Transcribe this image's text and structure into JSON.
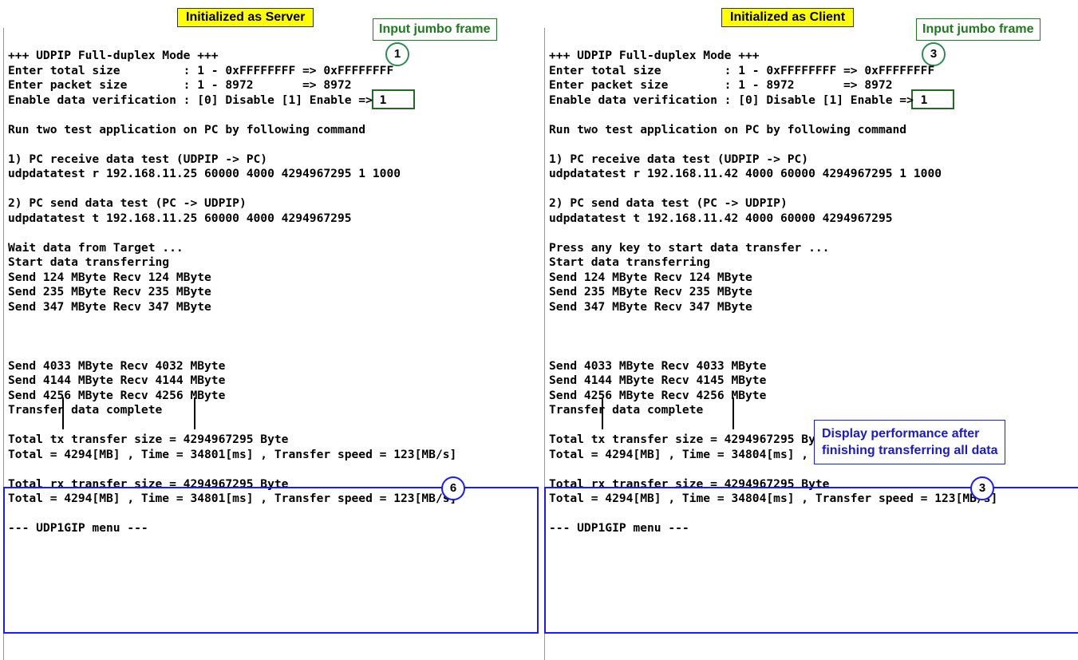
{
  "server": {
    "title": "Initialized as Server",
    "callout": "Input jumbo frame",
    "callout_step": "1",
    "result_step": "6",
    "lines": [
      "+++ UDPIP Full-duplex Mode +++",
      "Enter total size         : 1 - 0xFFFFFFFF => 0xFFFFFFFF",
      "Enter packet size        : 1 - 8972       => 8972",
      "Enable data verification : [0] Disable [1] Enable => 1",
      "Run two test application on PC by following command",
      "1) PC receive data test (UDPIP -> PC)",
      "udpdatatest r 192.168.11.25 60000 4000 4294967295 1 1000",
      "2) PC send data test (PC -> UDPIP)",
      "udpdatatest t 192.168.11.25 60000 4000 4294967295",
      "Wait data from Target ...",
      "Start data transferring",
      "Send 124 MByte Recv 124 MByte",
      "Send 235 MByte Recv 235 MByte",
      "Send 347 MByte Recv 347 MByte",
      "Send 4033 MByte Recv 4032 MByte",
      "Send 4144 MByte Recv 4144 MByte",
      "Send 4256 MByte Recv 4256 MByte",
      "Transfer data complete",
      "Total tx transfer size = 4294967295 Byte",
      "Total = 4294[MB] , Time = 34801[ms] , Transfer speed = 123[MB/s]",
      "Total rx transfer size = 4294967295 Byte",
      "Total = 4294[MB] , Time = 34801[ms] , Transfer speed = 123[MB/s]",
      "--- UDP1GIP menu ---"
    ]
  },
  "client": {
    "title": "Initialized as Client",
    "callout": "Input jumbo frame",
    "callout_step": "3",
    "result_step": "3",
    "note": [
      "Display performance after",
      "finishing transferring all data"
    ],
    "lines": [
      "+++ UDPIP Full-duplex Mode +++",
      "Enter total size         : 1 - 0xFFFFFFFF => 0xFFFFFFFF",
      "Enter packet size        : 1 - 8972       => 8972",
      "Enable data verification : [0] Disable [1] Enable => 1",
      "Run two test application on PC by following command",
      "1) PC receive data test (UDPIP -> PC)",
      "udpdatatest r 192.168.11.42 4000 60000 4294967295 1 1000",
      "2) PC send data test (PC -> UDPIP)",
      "udpdatatest t 192.168.11.42 4000 60000 4294967295",
      "Press any key to start data transfer ...",
      "Start data transferring",
      "Send 124 MByte Recv 124 MByte",
      "Send 235 MByte Recv 235 MByte",
      "Send 347 MByte Recv 347 MByte",
      "Send 4033 MByte Recv 4033 MByte",
      "Send 4144 MByte Recv 4145 MByte",
      "Send 4256 MByte Recv 4256 MByte",
      "Transfer data complete",
      "Total tx transfer size = 4294967295 Byte",
      "Total = 4294[MB] , Time = 34804[ms] , Transfer speed = 123[MB/s]",
      "Total rx transfer size = 4294967295 Byte",
      "Total = 4294[MB] , Time = 34804[ms] , Transfer speed = 123[MB/s]",
      "--- UDP1GIP menu ---"
    ]
  }
}
